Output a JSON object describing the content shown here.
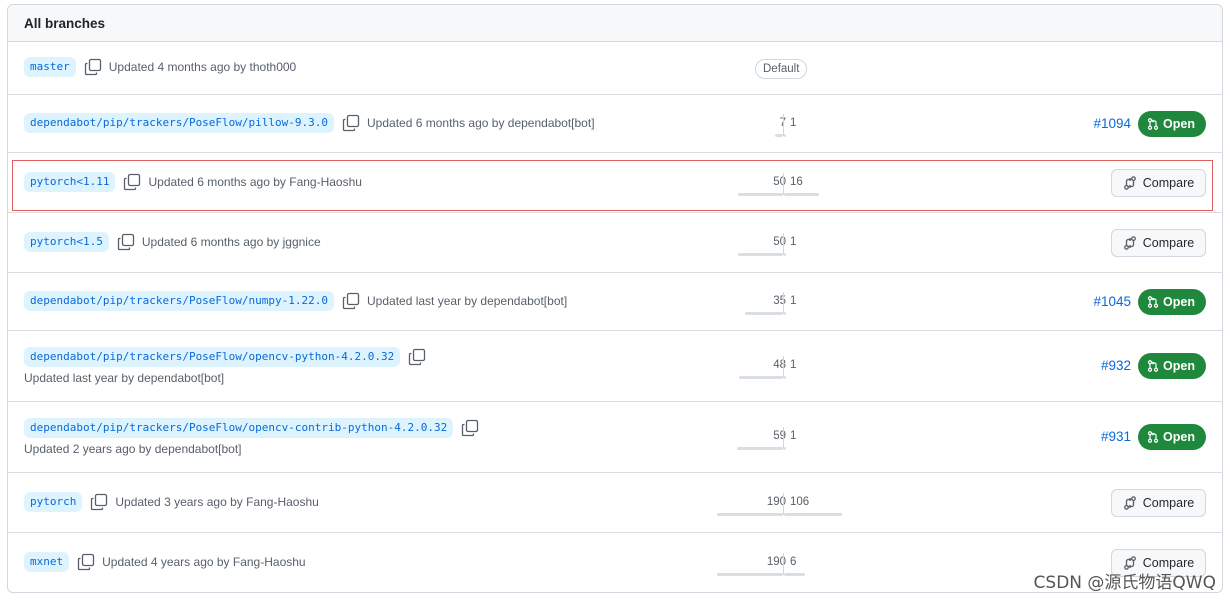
{
  "header": {
    "title": "All branches"
  },
  "labels": {
    "default_badge": "Default",
    "open": "Open",
    "compare": "Compare"
  },
  "branches": [
    {
      "name": "master",
      "updated": "Updated 4 months ago by thoth000",
      "is_default": true
    },
    {
      "name": "dependabot/pip/trackers/PoseFlow/pillow-9.3.0",
      "updated": "Updated 6 months ago by dependabot[bot]",
      "behind": "7",
      "ahead": "1",
      "pr": "#1094",
      "action": "open"
    },
    {
      "name": "pytorch<1.11",
      "updated": "Updated 6 months ago by Fang-Haoshu",
      "behind": "50",
      "ahead": "16",
      "action": "compare"
    },
    {
      "name": "pytorch<1.5",
      "updated": "Updated 6 months ago by jggnice",
      "behind": "50",
      "ahead": "1",
      "action": "compare"
    },
    {
      "name": "dependabot/pip/trackers/PoseFlow/numpy-1.22.0",
      "updated": "Updated last year by dependabot[bot]",
      "behind": "35",
      "ahead": "1",
      "pr": "#1045",
      "action": "open"
    },
    {
      "name": "dependabot/pip/trackers/PoseFlow/opencv-python-4.2.0.32",
      "updated": "Updated last year by dependabot[bot]",
      "behind": "48",
      "ahead": "1",
      "pr": "#932",
      "action": "open"
    },
    {
      "name": "dependabot/pip/trackers/PoseFlow/opencv-contrib-python-4.2.0.32",
      "updated": "Updated 2 years ago by dependabot[bot]",
      "behind": "59",
      "ahead": "1",
      "pr": "#931",
      "action": "open"
    },
    {
      "name": "pytorch",
      "updated": "Updated 3 years ago by Fang-Haoshu",
      "behind": "190",
      "ahead": "106",
      "action": "compare"
    },
    {
      "name": "mxnet",
      "updated": "Updated 4 years ago by Fang-Haoshu",
      "behind": "190",
      "ahead": "6",
      "action": "compare"
    }
  ],
  "watermark": "CSDN @源氏物语QWQ",
  "colors": {
    "accent": "#0969da",
    "open_green": "#1f883d",
    "highlight_border": "#e06060"
  }
}
